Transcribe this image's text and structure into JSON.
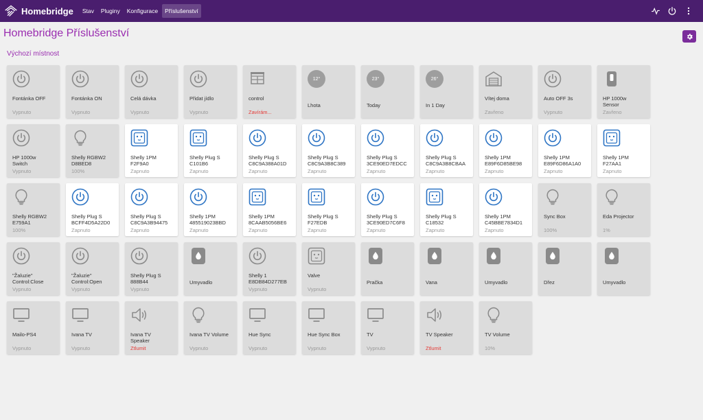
{
  "nav": {
    "brand": "Homebridge",
    "links": [
      {
        "label": "Stav",
        "active": false
      },
      {
        "label": "Pluginy",
        "active": false
      },
      {
        "label": "Konfigurace",
        "active": false
      },
      {
        "label": "Příslušenství",
        "active": true
      }
    ],
    "right_icons": [
      "status-pulse-icon",
      "power-icon",
      "more-vertical-icon"
    ]
  },
  "page": {
    "title": "Homebridge Příslušenství",
    "room": "Výchozí místnost",
    "settings_icon": "gear-icon"
  },
  "colors": {
    "navbar": "#4a1e6e",
    "accent": "#9a2db0",
    "on_blue": "#2d74c4",
    "off_gray": "#8a8a8a",
    "warn": "#e53935"
  },
  "tiles": [
    {
      "name": "Fontánka OFF",
      "status": "Vypnuto",
      "icon": "power",
      "on": false
    },
    {
      "name": "Fontánka ON",
      "status": "Vypnuto",
      "icon": "power",
      "on": false
    },
    {
      "name": "Celá dávka",
      "status": "Vypnuto",
      "icon": "power",
      "on": false
    },
    {
      "name": "Přidat jídlo",
      "status": "Vypnuto",
      "icon": "power",
      "on": false
    },
    {
      "name": "control",
      "status": "Zavírám...",
      "icon": "blinds",
      "on": false,
      "warn": true
    },
    {
      "name": "Lhota",
      "status": "",
      "icon": "temp",
      "temp": "12°",
      "on": false,
      "lower": true
    },
    {
      "name": "Today",
      "status": "",
      "icon": "temp",
      "temp": "23°",
      "on": false,
      "lower": true
    },
    {
      "name": "In 1 Day",
      "status": "",
      "icon": "temp",
      "temp": "26°",
      "on": false,
      "lower": true
    },
    {
      "name": "Vítej doma",
      "status": "Zavřeno",
      "icon": "garage",
      "on": false
    },
    {
      "name": "Auto OFF 3s",
      "status": "Vypnuto",
      "icon": "power",
      "on": false
    },
    {
      "name": "HP 1000w\nSensor",
      "status": "Zavřeno",
      "icon": "sensor",
      "on": false
    },
    {
      "name": "HP 1000w\nSwitch",
      "status": "Vypnuto",
      "icon": "power",
      "on": false
    },
    {
      "name": "Shelly RGBW2\nD8BED8",
      "status": "100%",
      "icon": "bulb",
      "on": false
    },
    {
      "name": "Shelly 1PM\nF2F9A0",
      "status": "Zapnuto",
      "icon": "outlet",
      "on": true
    },
    {
      "name": "Shelly Plug S\nC101B6",
      "status": "Zapnuto",
      "icon": "outlet",
      "on": true
    },
    {
      "name": "Shelly Plug S\nC8C9A388A01D",
      "status": "Zapnuto",
      "icon": "power",
      "on": true
    },
    {
      "name": "Shelly Plug S\nC8C9A3B8C389",
      "status": "Zapnuto",
      "icon": "power",
      "on": true
    },
    {
      "name": "Shelly Plug S\n3CE90ED7EDCC",
      "status": "Zapnuto",
      "icon": "power",
      "on": true
    },
    {
      "name": "Shelly Plug S\nC8C9A3B8CBAA",
      "status": "Zapnuto",
      "icon": "power",
      "on": true
    },
    {
      "name": "Shelly 1PM\nE89F6D85BE98",
      "status": "Zapnuto",
      "icon": "power",
      "on": true
    },
    {
      "name": "Shelly 1PM\nE89F6D86A1A0",
      "status": "Zapnuto",
      "icon": "power",
      "on": true
    },
    {
      "name": "Shelly 1PM\nF27AA1",
      "status": "Zapnuto",
      "icon": "outlet",
      "on": true
    },
    {
      "name": "Shelly RGBW2\nE759A1",
      "status": "100%",
      "icon": "bulb",
      "on": false
    },
    {
      "name": "Shelly Plug S\nBCFF4D5A22D0",
      "status": "Zapnuto",
      "icon": "power",
      "on": true
    },
    {
      "name": "Shelly Plug S\nC8C9A3B94475",
      "status": "Zapnuto",
      "icon": "power",
      "on": true
    },
    {
      "name": "Shelly 1PM\n485519023BBD",
      "status": "Zapnuto",
      "icon": "power",
      "on": true
    },
    {
      "name": "Shelly 1PM\n8CAAB5056BE6",
      "status": "Zapnuto",
      "icon": "outlet",
      "on": true
    },
    {
      "name": "Shelly Plug S\nF27EDB",
      "status": "Zapnuto",
      "icon": "outlet",
      "on": true
    },
    {
      "name": "Shelly Plug S\n3CE90ED7C6F8",
      "status": "Zapnuto",
      "icon": "power",
      "on": true
    },
    {
      "name": "Shelly Plug S\nC18532",
      "status": "Zapnuto",
      "icon": "outlet",
      "on": true
    },
    {
      "name": "Shelly 1PM\nC45BBE7834D1",
      "status": "Zapnuto",
      "icon": "power",
      "on": true
    },
    {
      "name": "Sync Box",
      "status": "100%",
      "icon": "bulb",
      "on": false
    },
    {
      "name": "Eda Projector",
      "status": "1%",
      "icon": "bulb",
      "on": false
    },
    {
      "name": "\"Žaluzie\"\nControl:Close",
      "status": "Vypnuto",
      "icon": "power",
      "on": false
    },
    {
      "name": "\"Žaluzie\"\nControl:Open",
      "status": "Vypnuto",
      "icon": "power",
      "on": false
    },
    {
      "name": "Shelly Plug S\n888B44",
      "status": "Vypnuto",
      "icon": "power",
      "on": false
    },
    {
      "name": "Umyvadlo",
      "status": "",
      "icon": "drop",
      "on": false,
      "lower": true
    },
    {
      "name": "Shelly 1\nE8DB84D277EB",
      "status": "Vypnuto",
      "icon": "power",
      "on": false
    },
    {
      "name": "Valve",
      "status": "Vypnuto",
      "icon": "outlet",
      "on": false
    },
    {
      "name": "Pračka",
      "status": "",
      "icon": "drop",
      "on": false,
      "lower": true
    },
    {
      "name": "Vana",
      "status": "",
      "icon": "drop",
      "on": false,
      "lower": true
    },
    {
      "name": "Umyvadlo",
      "status": "",
      "icon": "drop",
      "on": false,
      "lower": true
    },
    {
      "name": "Dřez",
      "status": "",
      "icon": "drop",
      "on": false,
      "lower": true
    },
    {
      "name": "Umyvadlo",
      "status": "",
      "icon": "drop",
      "on": false,
      "lower": true
    },
    {
      "name": "Mailo-PS4",
      "status": "Vypnuto",
      "icon": "tv",
      "on": false
    },
    {
      "name": "Ivana TV",
      "status": "Vypnuto",
      "icon": "tv",
      "on": false
    },
    {
      "name": "Ivana TV\nSpeaker",
      "status": "Ztlumit",
      "icon": "speaker",
      "on": false,
      "warn": true
    },
    {
      "name": "Ivana TV Volume",
      "status": "Vypnuto",
      "icon": "bulb",
      "on": false
    },
    {
      "name": "Hue Sync",
      "status": "Vypnuto",
      "icon": "tv",
      "on": false
    },
    {
      "name": "Hue Sync Box",
      "status": "Vypnuto",
      "icon": "tv",
      "on": false
    },
    {
      "name": "TV",
      "status": "Vypnuto",
      "icon": "tv",
      "on": false
    },
    {
      "name": "TV Speaker",
      "status": "Ztlumit",
      "icon": "speaker",
      "on": false,
      "warn": true
    },
    {
      "name": "TV Volume",
      "status": "10%",
      "icon": "bulb",
      "on": false
    }
  ]
}
